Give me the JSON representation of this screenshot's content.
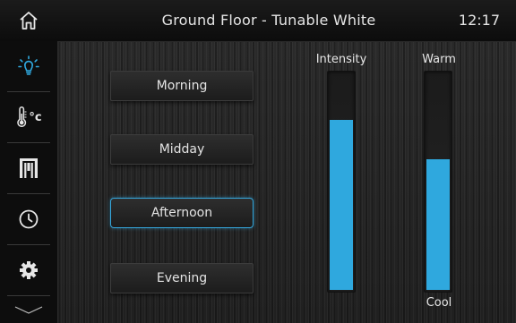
{
  "header": {
    "title": "Ground Floor - Tunable White",
    "time": "12:17"
  },
  "sidebar": {
    "items": [
      {
        "name": "lighting",
        "icon": "light-bulb-icon",
        "active": true
      },
      {
        "name": "temperature",
        "icon": "thermometer-icon",
        "label": "°c"
      },
      {
        "name": "blinds",
        "icon": "blinds-icon"
      },
      {
        "name": "schedule",
        "icon": "clock-icon"
      },
      {
        "name": "settings",
        "icon": "gear-icon"
      },
      {
        "name": "more",
        "icon": "chevron-down-icon"
      }
    ]
  },
  "presets": [
    {
      "label": "Morning",
      "active": false
    },
    {
      "label": "Midday",
      "active": false
    },
    {
      "label": "Afternoon",
      "active": true
    },
    {
      "label": "Evening",
      "active": false
    }
  ],
  "sliders": {
    "intensity": {
      "label": "Intensity",
      "level": 0.78
    },
    "warmth": {
      "top_label": "Warm",
      "bottom_label": "Cool",
      "level": 0.6
    }
  },
  "colors": {
    "accent": "#2fa8de",
    "background": "#111111"
  }
}
